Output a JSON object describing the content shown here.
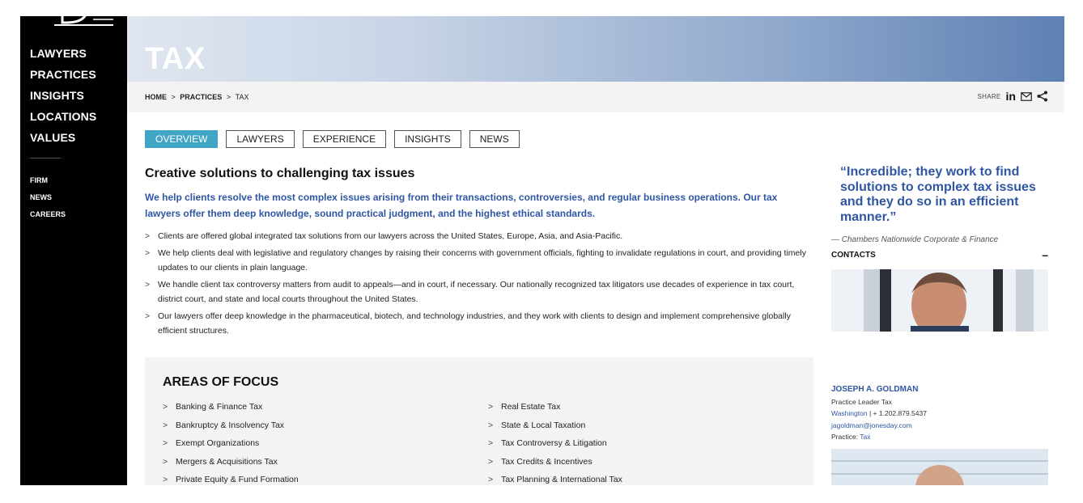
{
  "sidebar": {
    "main_items": [
      {
        "label": "LAWYERS"
      },
      {
        "label": "PRACTICES"
      },
      {
        "label": "INSIGHTS"
      },
      {
        "label": "LOCATIONS"
      },
      {
        "label": "VALUES"
      }
    ],
    "sub_items": [
      {
        "label": "FIRM"
      },
      {
        "label": "NEWS"
      },
      {
        "label": "CAREERS"
      }
    ]
  },
  "banner": {
    "title": "TAX"
  },
  "breadcrumb": {
    "home": "HOME",
    "separator": ">",
    "practices": "PRACTICES",
    "current": "TAX"
  },
  "share": {
    "label": "SHARE",
    "linkedin_glyph": "in"
  },
  "tabs": [
    {
      "label": "OVERVIEW",
      "active": true
    },
    {
      "label": "LAWYERS"
    },
    {
      "label": "EXPERIENCE"
    },
    {
      "label": "INSIGHTS"
    },
    {
      "label": "NEWS"
    }
  ],
  "main": {
    "heading": "Creative solutions to challenging tax issues",
    "lead": "We help clients resolve the most complex issues arising from their transactions, controversies, and regular business operations. Our tax lawyers offer them deep knowledge, sound practical judgment, and the highest ethical standards.",
    "bullets": [
      "Clients are offered global integrated tax solutions from our lawyers across the United States, Europe, Asia, and Asia-Pacific.",
      "We help clients deal with legislative and regulatory changes by raising their concerns with government officials, fighting to invalidate regulations in court, and providing timely updates to our clients in plain language.",
      "We handle client tax controversy matters from audit to appeals—and in court, if necessary. Our nationally recognized tax litigators use decades of experience in tax court, district court, and state and local courts throughout the United States.",
      "Our lawyers offer deep knowledge in the pharmaceutical, biotech, and technology industries, and they work with clients to design and implement comprehensive globally efficient structures."
    ]
  },
  "focus": {
    "title": "AREAS OF FOCUS",
    "left": [
      "Banking & Finance Tax",
      "Bankruptcy & Insolvency Tax",
      "Exempt Organizations",
      "Mergers & Acquisitions Tax",
      "Private Equity & Fund Formation"
    ],
    "right": [
      "Real Estate Tax",
      "State & Local Taxation",
      "Tax Controversy & Litigation",
      "Tax Credits & Incentives",
      "Tax Planning & International Tax"
    ]
  },
  "quote": {
    "text": "“Incredible; they work to find solutions to complex tax issues and they do so in an efficient manner.”",
    "source": "—  Chambers Nationwide Corporate & Finance"
  },
  "contacts": {
    "heading": "CONTACTS",
    "collapse_glyph": "–",
    "person": {
      "name": "JOSEPH A. GOLDMAN",
      "title": "Practice Leader Tax",
      "office": "Washington",
      "divider": "|",
      "phone": "+ 1.202.879.5437",
      "email": "jagoldman@jonesday.com",
      "practice_label": "Practice:",
      "practice": "Tax"
    }
  },
  "colors": {
    "accent_blue": "#2f56a2",
    "tab_active": "#41a6c5",
    "sidebar_bg": "#000000"
  }
}
